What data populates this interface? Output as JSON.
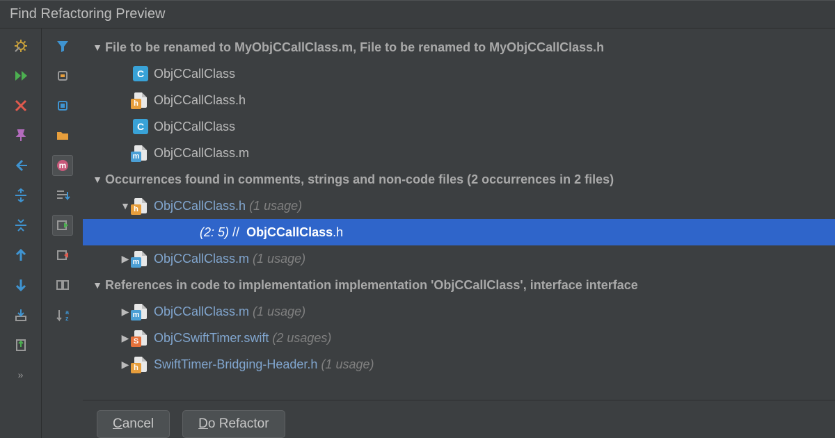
{
  "titlebar": {
    "title": "Find Refactoring Preview"
  },
  "tree": {
    "section1": {
      "label": "File to be renamed to MyObjCCallClass.m, File to be renamed to MyObjCCallClass.h",
      "items": [
        {
          "icon": "class",
          "name": "ObjCCallClass"
        },
        {
          "icon": "h",
          "name": "ObjCCallClass.h"
        },
        {
          "icon": "class",
          "name": "ObjCCallClass"
        },
        {
          "icon": "m",
          "name": "ObjCCallClass.m"
        }
      ]
    },
    "section2": {
      "label": "Occurrences found in comments, strings and non-code files  (2 occurrences in 2 files)",
      "items": [
        {
          "icon": "h",
          "name": "ObjCCallClass.h",
          "usage": "(1 usage)"
        }
      ],
      "selected": {
        "pos": "(2: 5)",
        "sep": "//",
        "strong": "ObjCCallClass",
        "rest": ".h"
      },
      "after": [
        {
          "icon": "m",
          "name": "ObjCCallClass.m",
          "usage": "(1 usage)"
        }
      ]
    },
    "section3": {
      "label": "References in code to implementation implementation 'ObjCCallClass', interface interface",
      "items": [
        {
          "icon": "m",
          "name": "ObjCCallClass.m",
          "usage": "(1 usage)"
        },
        {
          "icon": "s",
          "name": "ObjCSwiftTimer.swift",
          "usage": "(2 usages)"
        },
        {
          "icon": "h",
          "name": "SwiftTimer-Bridging-Header.h",
          "usage": "(1 usage)"
        }
      ]
    }
  },
  "buttons": {
    "cancel": "Cancel",
    "doRefactor": "Do Refactor"
  },
  "icons": {
    "badge_h": "h",
    "badge_m": "m",
    "badge_s": "S",
    "class": "C"
  },
  "toolbar1": [
    "settings",
    "rerun",
    "cancel-search",
    "pin",
    "prev",
    "expand-all",
    "collapse-selected",
    "up",
    "down",
    "export"
  ],
  "toolbar2": [
    "filter",
    "group-by-1",
    "group-by-2",
    "group-by-3",
    "method-m",
    "sort-1",
    "diff-prev",
    "diff-next",
    "panel",
    "sort-az"
  ]
}
